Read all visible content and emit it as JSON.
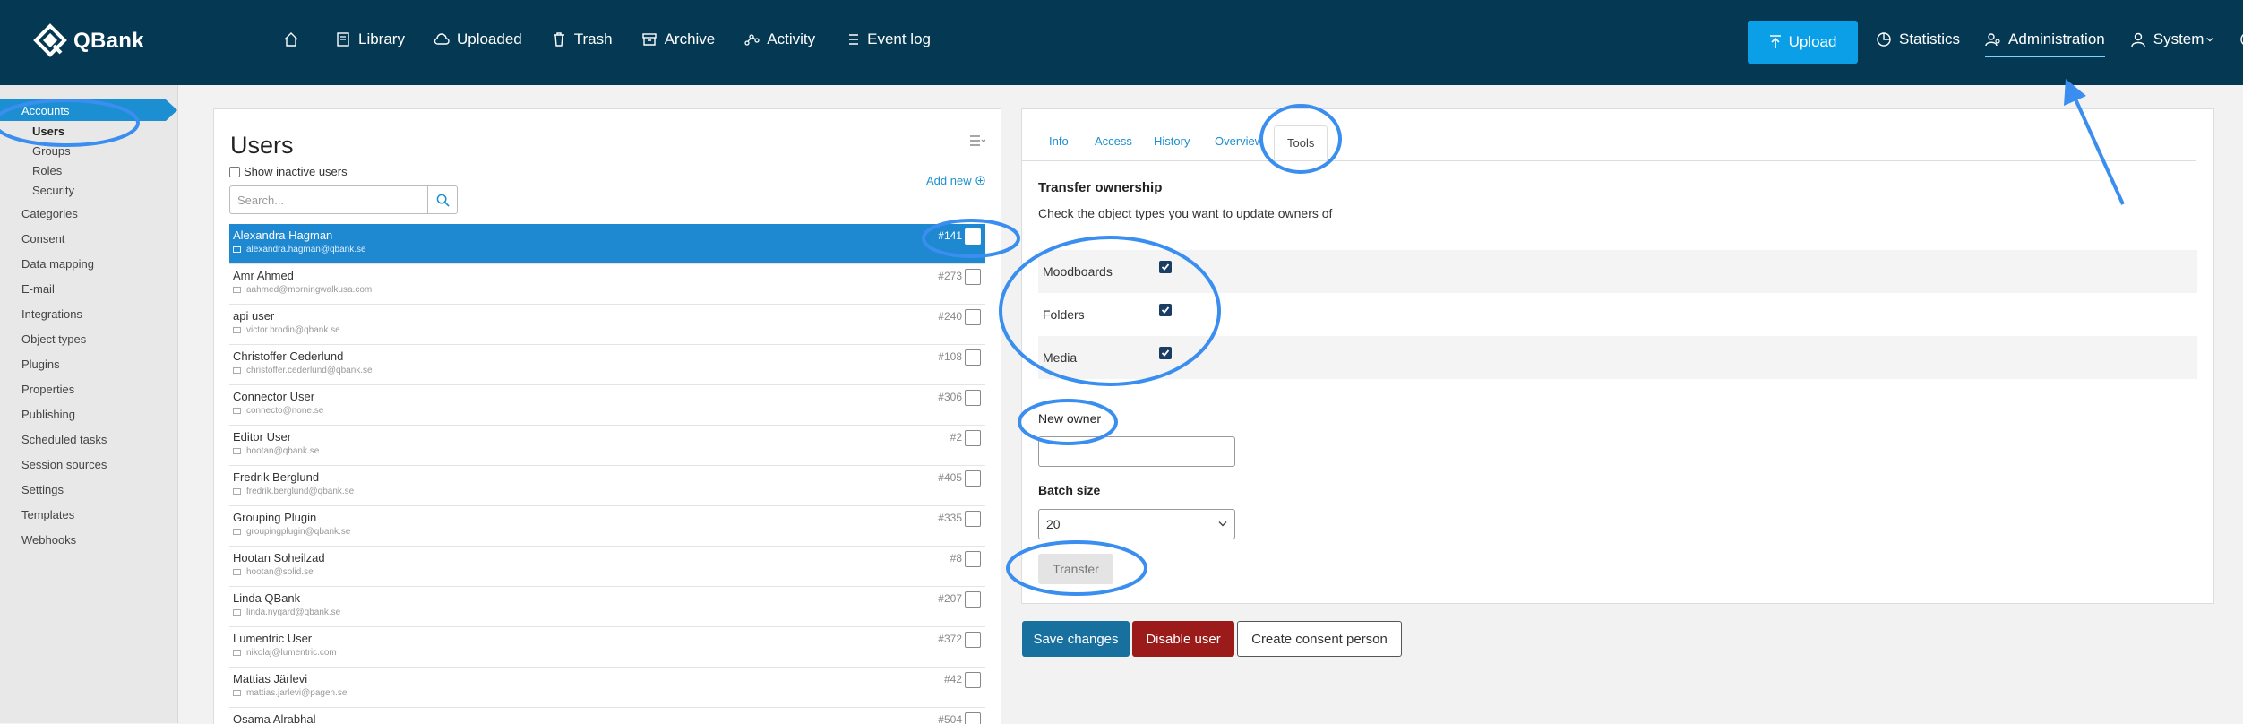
{
  "app": {
    "name": "QBank"
  },
  "topnav": {
    "items": [
      {
        "icon": "home-icon",
        "label": ""
      },
      {
        "icon": "library-icon",
        "label": "Library"
      },
      {
        "icon": "cloud-icon",
        "label": "Uploaded"
      },
      {
        "icon": "trash-icon",
        "label": "Trash"
      },
      {
        "icon": "archive-icon",
        "label": "Archive"
      },
      {
        "icon": "activity-icon",
        "label": "Activity"
      },
      {
        "icon": "list-icon",
        "label": "Event log"
      }
    ],
    "upload_label": "Upload",
    "right": {
      "statistics": "Statistics",
      "administration": "Administration",
      "system": "System"
    }
  },
  "sidebar": {
    "accounts": "Accounts",
    "sub": [
      "Users",
      "Groups",
      "Roles",
      "Security"
    ],
    "items": [
      "Categories",
      "Consent",
      "Data mapping",
      "E-mail",
      "Integrations",
      "Object types",
      "Plugins",
      "Properties",
      "Publishing",
      "Scheduled tasks",
      "Session sources",
      "Settings",
      "Templates",
      "Webhooks"
    ]
  },
  "users": {
    "title": "Users",
    "show_inactive": "Show inactive users",
    "add_new": "Add new",
    "search_placeholder": "Search...",
    "rows": [
      {
        "name": "Alexandra Hagman",
        "email": "alexandra.hagman@qbank.se",
        "id": "#141",
        "selected": true
      },
      {
        "name": "Amr Ahmed",
        "email": "aahmed@morningwalkusa.com",
        "id": "#273"
      },
      {
        "name": "api user",
        "email": "victor.brodin@qbank.se",
        "id": "#240"
      },
      {
        "name": "Christoffer Cederlund",
        "email": "christoffer.cederlund@qbank.se",
        "id": "#108"
      },
      {
        "name": "Connector User",
        "email": "connecto@none.se",
        "id": "#306"
      },
      {
        "name": "Editor User",
        "email": "hootan@qbank.se",
        "id": "#2"
      },
      {
        "name": "Fredrik Berglund",
        "email": "fredrik.berglund@qbank.se",
        "id": "#405"
      },
      {
        "name": "Grouping Plugin",
        "email": "groupingplugin@qbank.se",
        "id": "#335"
      },
      {
        "name": "Hootan Soheilzad",
        "email": "hootan@solid.se",
        "id": "#8"
      },
      {
        "name": "Linda QBank",
        "email": "linda.nygard@qbank.se",
        "id": "#207"
      },
      {
        "name": "Lumentric User",
        "email": "nikolaj@lumentric.com",
        "id": "#372"
      },
      {
        "name": "Mattias Järlevi",
        "email": "mattias.jarlevi@pagen.se",
        "id": "#42"
      },
      {
        "name": "Osama Alrabhal",
        "email": "",
        "id": "#504"
      }
    ]
  },
  "detail": {
    "tabs": [
      "Info",
      "Access",
      "History",
      "Overview",
      "Tools"
    ],
    "active_tab": "Tools",
    "transfer_title": "Transfer ownership",
    "transfer_desc": "Check the object types you want to update owners of",
    "object_types": [
      {
        "label": "Moodboards",
        "checked": true
      },
      {
        "label": "Folders",
        "checked": true
      },
      {
        "label": "Media",
        "checked": true
      }
    ],
    "new_owner_label": "New owner",
    "new_owner_value": "",
    "batch_size_label": "Batch size",
    "batch_size_value": "20",
    "transfer_button": "Transfer"
  },
  "actions": {
    "save": "Save changes",
    "disable": "Disable user",
    "consent": "Create consent person"
  },
  "colors": {
    "topbar": "#053852",
    "accent": "#1b8fd1",
    "upload": "#0a9fe6",
    "save": "#17709e",
    "disable": "#9b1b1b",
    "annotation": "#3a8ef0"
  }
}
